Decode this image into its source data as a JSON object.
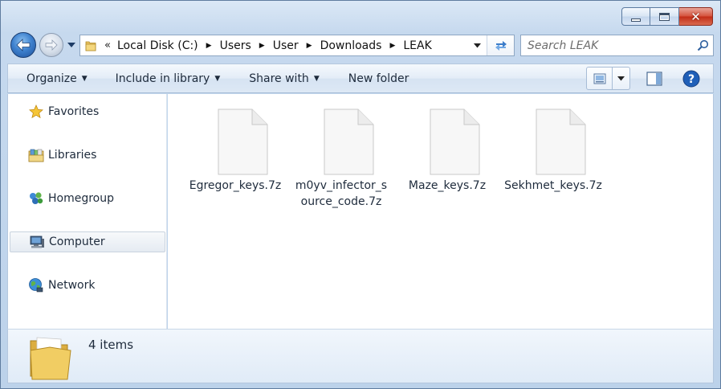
{
  "window": {
    "caption": {
      "minimize": "minimize",
      "maximize": "maximize",
      "close": "close"
    }
  },
  "address_bar": {
    "overflow_chevron": "«",
    "breadcrumbs": [
      "Local Disk (C:)",
      "Users",
      "User",
      "Downloads",
      "LEAK"
    ]
  },
  "search": {
    "placeholder": "Search LEAK"
  },
  "command_bar": {
    "organize": "Organize",
    "include_in_library": "Include in library",
    "share_with": "Share with",
    "new_folder": "New folder"
  },
  "nav_pane": {
    "items": [
      {
        "label": "Favorites",
        "icon": "star-icon"
      },
      {
        "label": "Libraries",
        "icon": "libraries-icon"
      },
      {
        "label": "Homegroup",
        "icon": "homegroup-icon"
      },
      {
        "label": "Computer",
        "icon": "computer-icon",
        "selected": true
      },
      {
        "label": "Network",
        "icon": "network-icon"
      }
    ]
  },
  "files": [
    {
      "name": "Egregor_keys.7z"
    },
    {
      "name": "m0yv_infector_source_code.7z"
    },
    {
      "name": "Maze_keys.7z"
    },
    {
      "name": "Sekhmet_keys.7z"
    }
  ],
  "details": {
    "item_count": "4 items"
  },
  "colors": {
    "chrome": "#c6d9ee",
    "close_red": "#c22d17",
    "accent_blue": "#3f82cf"
  }
}
